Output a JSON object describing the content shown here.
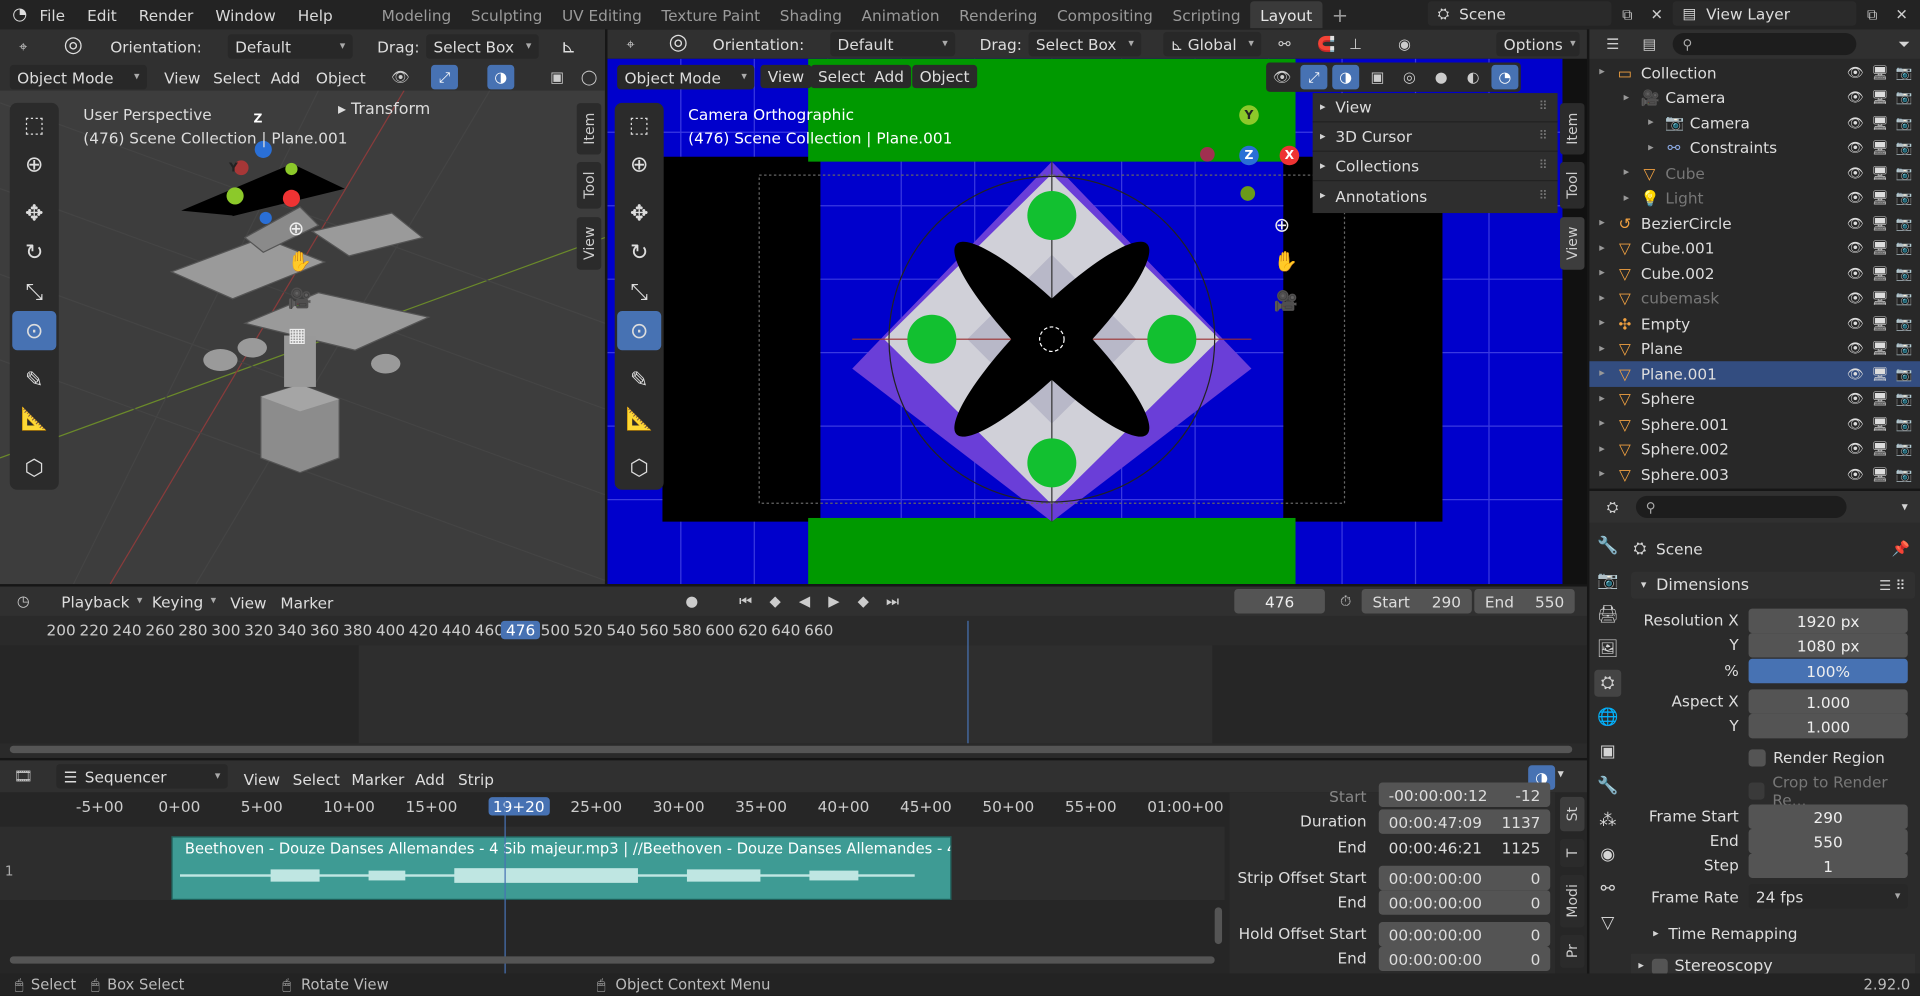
{
  "topbar": {
    "menus": [
      "File",
      "Edit",
      "Render",
      "Window",
      "Help"
    ],
    "workspaces": [
      "Modeling",
      "Sculpting",
      "UV Editing",
      "Texture Paint",
      "Shading",
      "Animation",
      "Rendering",
      "Compositing",
      "Scripting",
      "Layout"
    ],
    "active_workspace": "Layout",
    "scene": "Scene",
    "view_layer": "View Layer"
  },
  "viewport_left": {
    "orientation_label": "Orientation:",
    "orientation": "Default",
    "drag_label": "Drag:",
    "drag": "Select Box",
    "mode": "Object Mode",
    "menus": [
      "View",
      "Select",
      "Add",
      "Object"
    ],
    "info_line1": "User Perspective",
    "info_line2": "(476) Scene Collection | Plane.001",
    "panel": "Transform",
    "tabs": [
      "Item",
      "Tool",
      "View"
    ]
  },
  "viewport_right": {
    "orientation_label": "Orientation:",
    "orientation": "Default",
    "drag_label": "Drag:",
    "drag": "Select Box",
    "transform": "Global",
    "options": "Options",
    "mode": "Object Mode",
    "menus": [
      "View",
      "Select",
      "Add",
      "Object"
    ],
    "info_line1": "Camera Orthographic",
    "info_line2": "(476) Scene Collection | Plane.001",
    "sidebar_panels": [
      "View",
      "3D Cursor",
      "Collections",
      "Annotations"
    ],
    "tabs": [
      "Item",
      "Tool",
      "View"
    ]
  },
  "outliner": {
    "rows": [
      {
        "name": "Collection",
        "indent": 0,
        "dim": false,
        "icon": "collection"
      },
      {
        "name": "Camera",
        "indent": 1,
        "dim": false,
        "icon": "camera"
      },
      {
        "name": "Camera",
        "indent": 2,
        "dim": false,
        "icon": "camera-data"
      },
      {
        "name": "Constraints",
        "indent": 2,
        "dim": false,
        "icon": "constraint"
      },
      {
        "name": "Cube",
        "indent": 1,
        "dim": true,
        "icon": "mesh"
      },
      {
        "name": "Light",
        "indent": 1,
        "dim": true,
        "icon": "light"
      },
      {
        "name": "BezierCircle",
        "indent": 0,
        "dim": false,
        "icon": "curve"
      },
      {
        "name": "Cube.001",
        "indent": 0,
        "dim": false,
        "icon": "mesh"
      },
      {
        "name": "Cube.002",
        "indent": 0,
        "dim": false,
        "icon": "mesh"
      },
      {
        "name": "cubemask",
        "indent": 0,
        "dim": true,
        "icon": "mesh"
      },
      {
        "name": "Empty",
        "indent": 0,
        "dim": false,
        "icon": "empty"
      },
      {
        "name": "Plane",
        "indent": 0,
        "dim": false,
        "icon": "mesh"
      },
      {
        "name": "Plane.001",
        "indent": 0,
        "dim": false,
        "icon": "mesh"
      },
      {
        "name": "Sphere",
        "indent": 0,
        "dim": false,
        "icon": "mesh"
      },
      {
        "name": "Sphere.001",
        "indent": 0,
        "dim": false,
        "icon": "mesh"
      },
      {
        "name": "Sphere.002",
        "indent": 0,
        "dim": false,
        "icon": "mesh"
      },
      {
        "name": "Sphere.003",
        "indent": 0,
        "dim": false,
        "icon": "mesh"
      }
    ]
  },
  "properties": {
    "context": "Scene",
    "section": "Dimensions",
    "resolution_x_label": "Resolution X",
    "resolution_x": "1920 px",
    "resolution_y_label": "Y",
    "resolution_y": "1080 px",
    "percent_label": "%",
    "percent": "100%",
    "aspect_x_label": "Aspect X",
    "aspect_x": "1.000",
    "aspect_y_label": "Y",
    "aspect_y": "1.000",
    "render_region": "Render Region",
    "crop": "Crop to Render Re...",
    "frame_start_label": "Frame Start",
    "frame_start": "290",
    "end_label": "End",
    "end": "550",
    "step_label": "Step",
    "step": "1",
    "frame_rate_label": "Frame Rate",
    "frame_rate": "24 fps",
    "time_remapping": "Time Remapping",
    "stereoscopy": "Stereoscopy"
  },
  "timeline": {
    "menus": [
      "Playback",
      "Keying",
      "View",
      "Marker"
    ],
    "current_frame": "476",
    "start_label": "Start",
    "start": "290",
    "end_label": "End",
    "end": "550",
    "ticks": [
      "200",
      "220",
      "240",
      "260",
      "280",
      "300",
      "320",
      "340",
      "360",
      "380",
      "400",
      "420",
      "440",
      "460",
      "476",
      "500",
      "520",
      "540",
      "560",
      "580",
      "600",
      "620",
      "640",
      "660"
    ]
  },
  "sequencer": {
    "editor": "Sequencer",
    "menus": [
      "View",
      "Select",
      "Marker",
      "Add",
      "Strip"
    ],
    "ticks": [
      "-5+00",
      "0+00",
      "5+00",
      "10+00",
      "15+00",
      "19+20",
      "25+00",
      "30+00",
      "35+00",
      "40+00",
      "45+00",
      "50+00",
      "55+00",
      "01:00+00"
    ],
    "channel": "1",
    "strip_label": "Beethoven - Douze Danses Allemandes - 4 Sib majeur.mp3 | //Beethoven - Douze Danses Allemandes - 4 Sib majeur.",
    "side": {
      "start_label": "Start",
      "start_tc": "-00:00:00:12",
      "start_fr": "-12",
      "duration_label": "Duration",
      "duration_tc": "00:00:47:09",
      "duration_fr": "1137",
      "end_label": "End",
      "end_tc": "00:00:46:21",
      "end_fr": "1125",
      "strip_offset_start_label": "Strip Offset Start",
      "sos_tc": "00:00:00:00",
      "sos_fr": "0",
      "sos_end_label": "End",
      "soe_tc": "00:00:00:00",
      "soe_fr": "0",
      "hold_offset_start_label": "Hold Offset Start",
      "hos_tc": "00:00:00:00",
      "hos_fr": "0",
      "hoe_end_label": "End",
      "hoe_tc": "00:00:00:00",
      "hoe_fr": "0"
    },
    "tabs": [
      "St",
      "T",
      "Modi",
      "Pr"
    ]
  },
  "statusbar": {
    "select": "Select",
    "box_select": "Box Select",
    "rotate": "Rotate View",
    "context_menu": "Object Context Menu",
    "version": "2.92.0"
  },
  "colors": {
    "accent": "#4772b3",
    "blue_bg": "#0000cc",
    "green": "#009900",
    "purple": "#6a3ed8"
  }
}
